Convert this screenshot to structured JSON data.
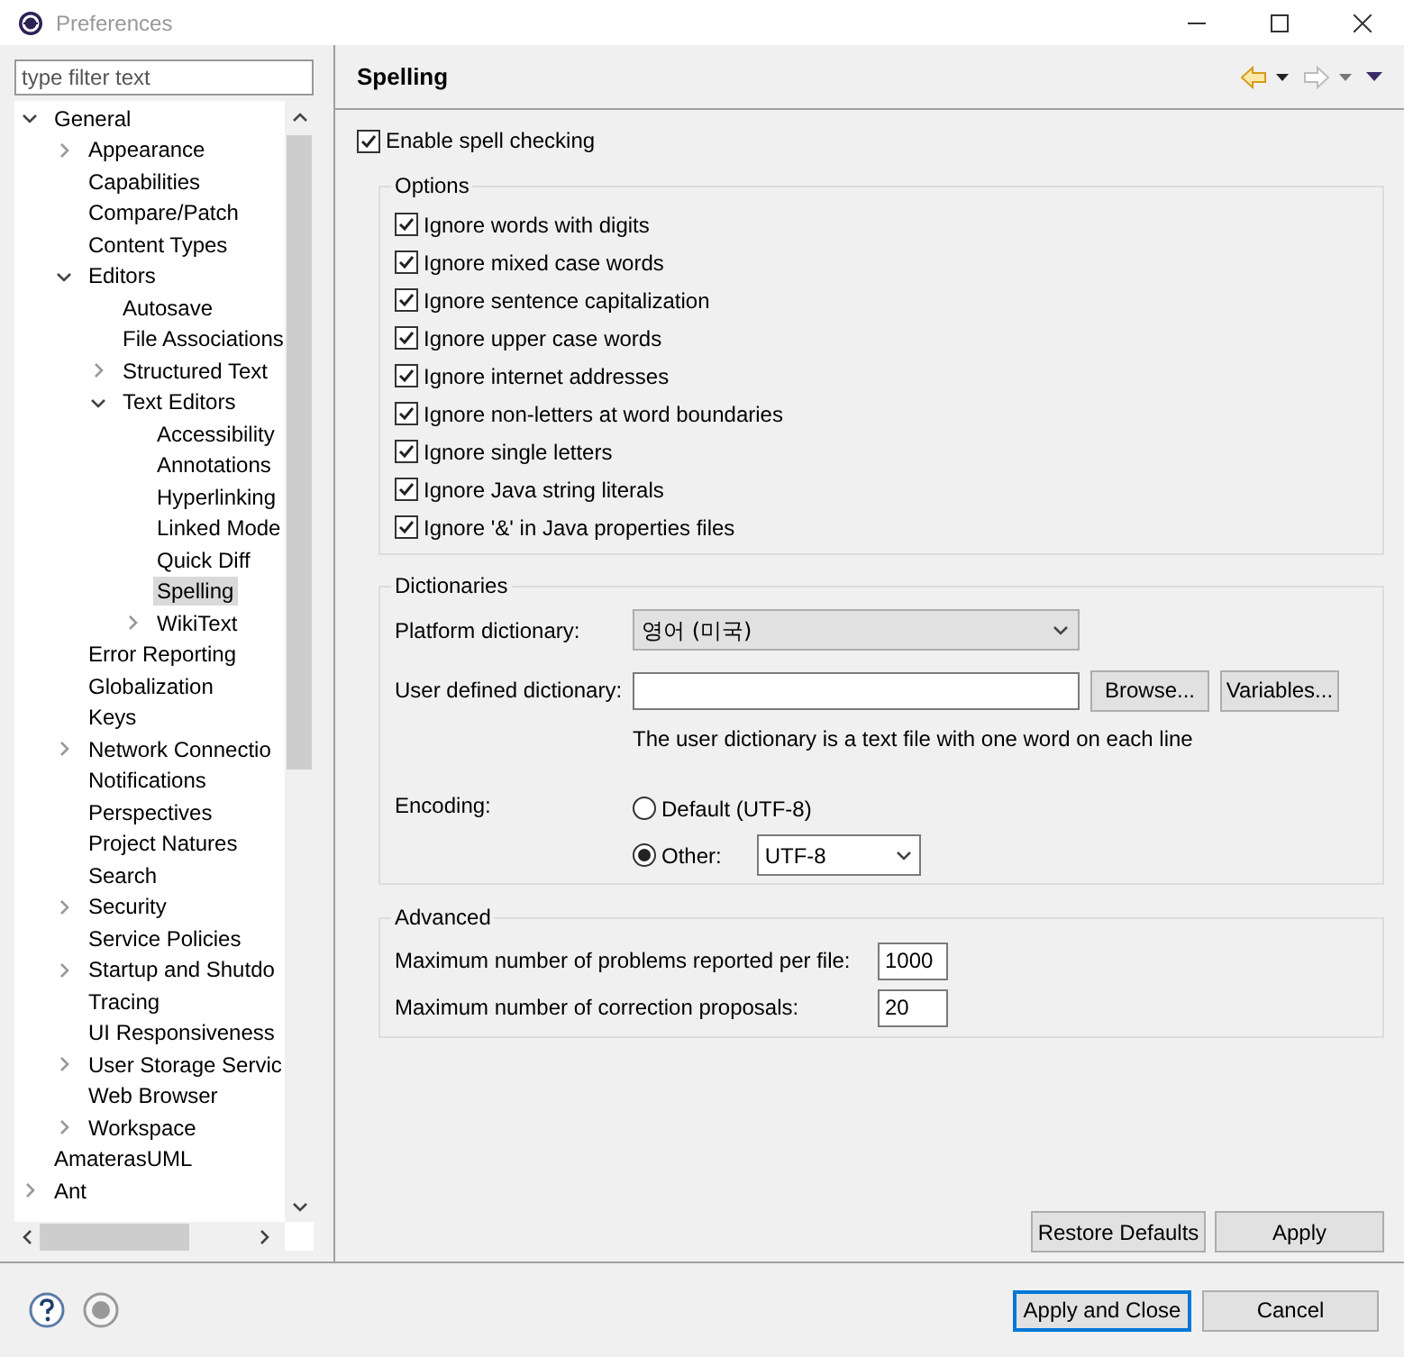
{
  "window": {
    "title": "Preferences"
  },
  "filter": {
    "placeholder": "type filter text"
  },
  "tree": [
    {
      "label": "General",
      "expanded": true,
      "selected": false,
      "children": [
        {
          "label": "Appearance",
          "expanded": false,
          "selected": false
        },
        {
          "label": "Capabilities",
          "selected": false
        },
        {
          "label": "Compare/Patch",
          "selected": false
        },
        {
          "label": "Content Types",
          "selected": false
        },
        {
          "label": "Editors",
          "expanded": true,
          "selected": false,
          "children": [
            {
              "label": "Autosave",
              "selected": false
            },
            {
              "label": "File Associations",
              "selected": false
            },
            {
              "label": "Structured Text",
              "expanded": false,
              "selected": false
            },
            {
              "label": "Text Editors",
              "expanded": true,
              "selected": false,
              "children": [
                {
                  "label": "Accessibility",
                  "selected": false
                },
                {
                  "label": "Annotations",
                  "selected": false
                },
                {
                  "label": "Hyperlinking",
                  "selected": false
                },
                {
                  "label": "Linked Mode",
                  "selected": false
                },
                {
                  "label": "Quick Diff",
                  "selected": false
                },
                {
                  "label": "Spelling",
                  "selected": true
                },
                {
                  "label": "WikiText",
                  "expanded": false,
                  "selected": false
                }
              ]
            }
          ]
        },
        {
          "label": "Error Reporting",
          "selected": false
        },
        {
          "label": "Globalization",
          "selected": false
        },
        {
          "label": "Keys",
          "selected": false
        },
        {
          "label": "Network Connectio",
          "expanded": false,
          "selected": false
        },
        {
          "label": "Notifications",
          "selected": false
        },
        {
          "label": "Perspectives",
          "selected": false
        },
        {
          "label": "Project Natures",
          "selected": false
        },
        {
          "label": "Search",
          "selected": false
        },
        {
          "label": "Security",
          "expanded": false,
          "selected": false
        },
        {
          "label": "Service Policies",
          "selected": false
        },
        {
          "label": "Startup and Shutdo",
          "expanded": false,
          "selected": false
        },
        {
          "label": "Tracing",
          "selected": false
        },
        {
          "label": "UI Responsiveness",
          "selected": false
        },
        {
          "label": "User Storage Servic",
          "expanded": false,
          "selected": false
        },
        {
          "label": "Web Browser",
          "selected": false
        },
        {
          "label": "Workspace",
          "expanded": false,
          "selected": false
        }
      ]
    },
    {
      "label": "AmaterasUML",
      "selected": false
    },
    {
      "label": "Ant",
      "expanded": false,
      "selected": false
    }
  ],
  "page": {
    "title": "Spelling",
    "enable": {
      "label": "Enable spell checking",
      "checked": true
    },
    "options": {
      "title": "Options",
      "items": [
        {
          "label": "Ignore words with digits",
          "checked": true
        },
        {
          "label": "Ignore mixed case words",
          "checked": true
        },
        {
          "label": "Ignore sentence capitalization",
          "checked": true
        },
        {
          "label": "Ignore upper case words",
          "checked": true
        },
        {
          "label": "Ignore internet addresses",
          "checked": true
        },
        {
          "label": "Ignore non-letters at word boundaries",
          "checked": true
        },
        {
          "label": "Ignore single letters",
          "checked": true
        },
        {
          "label": "Ignore Java string literals",
          "checked": true
        },
        {
          "label": "Ignore '&' in Java properties files",
          "checked": true
        }
      ]
    },
    "dictionaries": {
      "title": "Dictionaries",
      "platform_label": "Platform dictionary:",
      "platform_value": "영어 (미국)",
      "user_label": "User defined dictionary:",
      "browse": "Browse...",
      "variables": "Variables...",
      "hint": "The user dictionary is a text file with one word on each line",
      "encoding_label": "Encoding:",
      "encodings": [
        {
          "label": "Default (UTF-8)",
          "selected": false
        },
        {
          "label": "Other:",
          "selected": true,
          "value": "UTF-8"
        }
      ]
    },
    "advanced": {
      "title": "Advanced",
      "fields": [
        {
          "label": "Maximum number of problems reported per file:",
          "value": "1000"
        },
        {
          "label": "Maximum number of correction proposals:",
          "value": "20"
        }
      ]
    },
    "restore": "Restore Defaults",
    "apply": "Apply"
  },
  "buttons": {
    "apply_close": "Apply and Close",
    "cancel": "Cancel"
  }
}
